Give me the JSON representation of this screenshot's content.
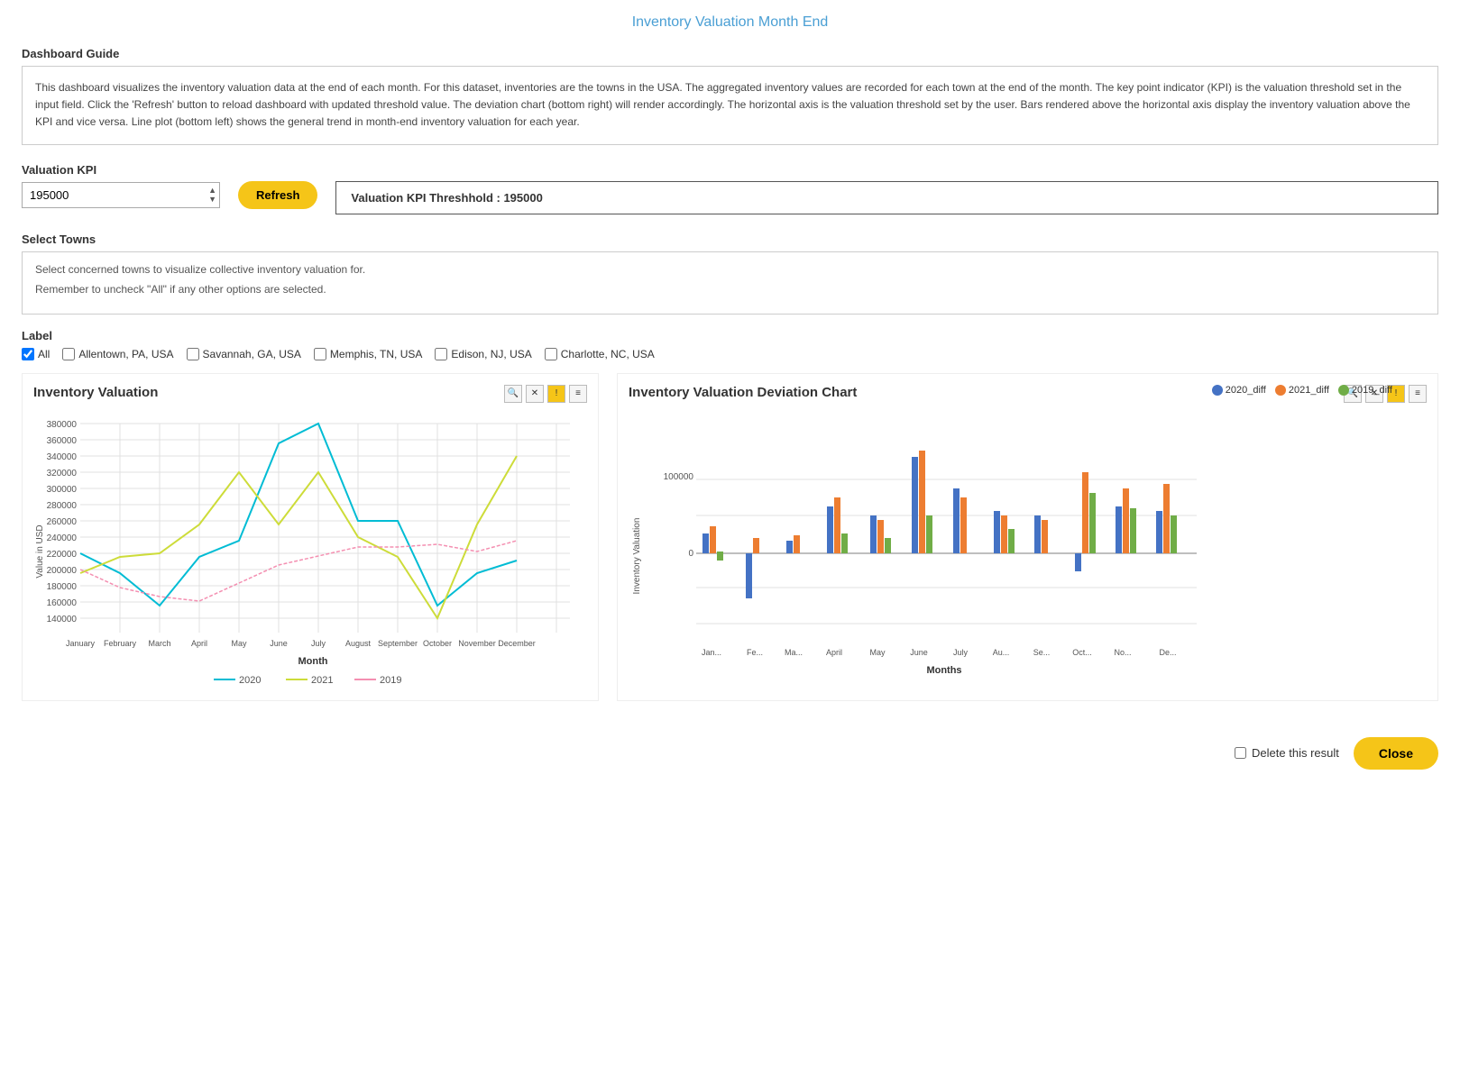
{
  "page": {
    "title": "Inventory Valuation Month End"
  },
  "guide": {
    "title": "Dashboard Guide",
    "text": "This dashboard visualizes the inventory valuation data at the end of each month. For this dataset, inventories are the towns in the USA. The aggregated inventory values are recorded for each town at the end of the month. The key point indicator (KPI) is the valuation threshold set in the input field. Click the 'Refresh' button to reload dashboard with updated threshold value. The deviation chart (bottom right) will render accordingly. The horizontal axis is the valuation threshold set by the user. Bars rendered above the horizontal axis display the inventory valuation above the KPI and vice versa. Line plot (bottom left) shows the general trend in month-end inventory valuation for each year."
  },
  "kpi": {
    "label": "Valuation KPI",
    "value": "195000",
    "refresh_label": "Refresh",
    "display_prefix": "Valuation KPI Threshhold : ",
    "display_value": "195000"
  },
  "towns": {
    "title": "Select Towns",
    "hint1": "Select concerned towns to visualize collective inventory valuation for.",
    "hint2": "Remember to uncheck \"All\" if any other options are selected."
  },
  "label_section": {
    "title": "Label",
    "checkboxes": [
      {
        "id": "all",
        "label": "All",
        "checked": true
      },
      {
        "id": "allentown",
        "label": "Allentown, PA, USA",
        "checked": false
      },
      {
        "id": "savannah",
        "label": "Savannah, GA, USA",
        "checked": false
      },
      {
        "id": "memphis",
        "label": "Memphis, TN, USA",
        "checked": false
      },
      {
        "id": "edison",
        "label": "Edison, NJ, USA",
        "checked": false
      },
      {
        "id": "charlotte",
        "label": "Charlotte, NC, USA",
        "checked": false
      }
    ]
  },
  "line_chart": {
    "title": "Inventory Valuation",
    "y_label": "Value in USD",
    "x_label": "Month",
    "legend": [
      {
        "label": "2020",
        "color": "#00bcd4"
      },
      {
        "label": "2021",
        "color": "#cddc39"
      },
      {
        "label": "2019",
        "color": "#f48fb1"
      }
    ],
    "y_ticks": [
      "380000",
      "360000",
      "340000",
      "320000",
      "300000",
      "280000",
      "260000",
      "240000",
      "220000",
      "200000",
      "180000",
      "160000",
      "140000"
    ],
    "x_ticks": [
      "January",
      "February",
      "March",
      "April",
      "May",
      "June",
      "July",
      "August",
      "September",
      "October",
      "November",
      "December"
    ]
  },
  "deviation_chart": {
    "title": "Inventory Valuation Deviation Chart",
    "y_label": "Inventory Valuation",
    "x_label": "Months",
    "legend": [
      {
        "label": "2020_diff",
        "color": "#4472c4"
      },
      {
        "label": "2021_diff",
        "color": "#ed7d31"
      },
      {
        "label": "2019_diff",
        "color": "#70ad47"
      }
    ],
    "x_ticks": [
      "Jan...",
      "Fe...",
      "Ma...",
      "April",
      "May",
      "June",
      "July",
      "Au...",
      "Se...",
      "Oct...",
      "No...",
      "De..."
    ]
  },
  "footer": {
    "delete_label": "Delete this result",
    "close_label": "Close"
  },
  "toolbar": {
    "zoom_icon": "🔍",
    "close_icon": "✕",
    "warning_icon": "!",
    "menu_icon": "≡"
  }
}
